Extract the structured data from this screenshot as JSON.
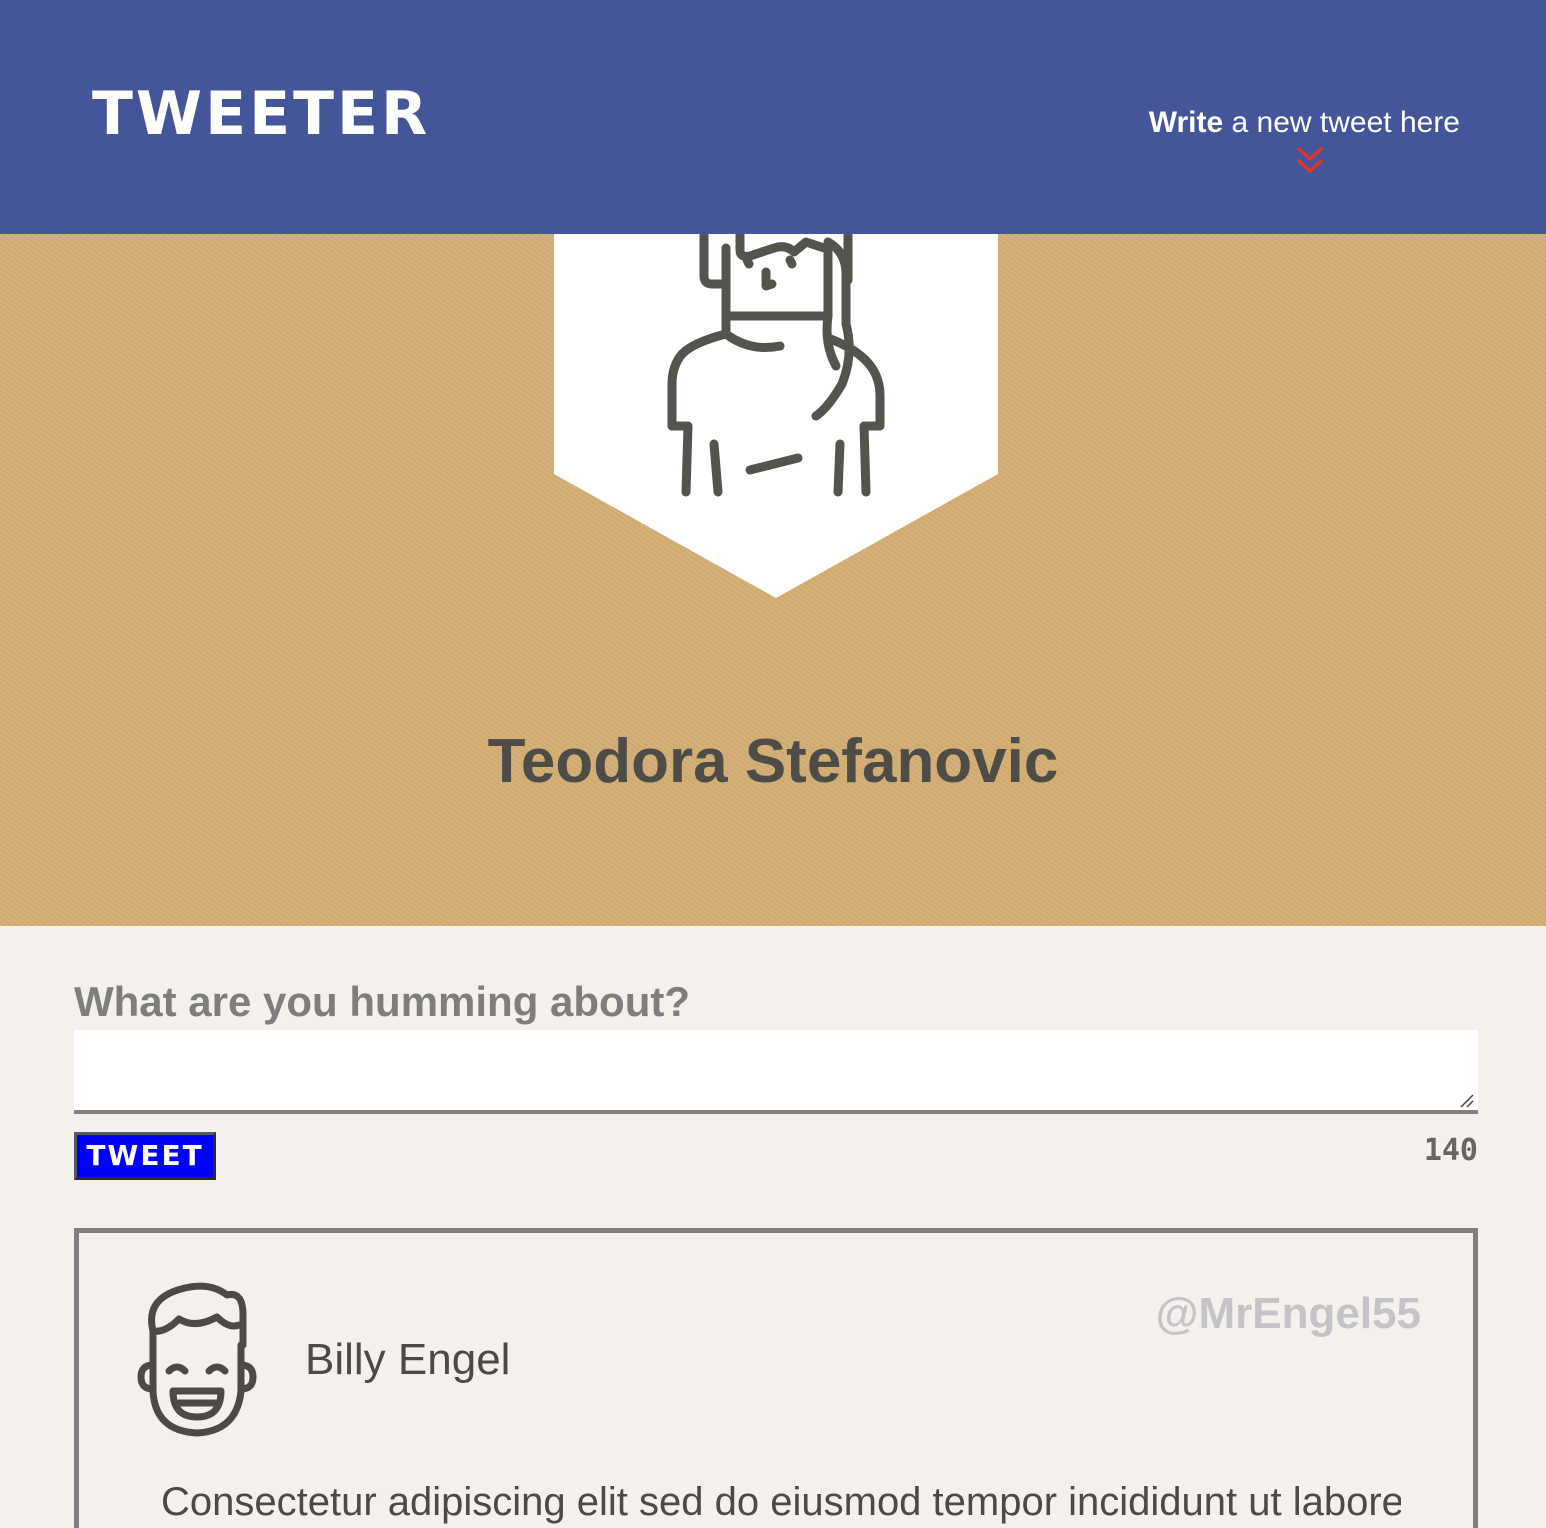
{
  "header": {
    "brand": "TWEETER",
    "compose_link_bold": "Write",
    "compose_link_rest": " a new tweet here",
    "chevron_icon": "chevron-double-down-icon",
    "chevron_color": "#e0342a",
    "background_color": "#45559a"
  },
  "profile": {
    "name": "Teodora Stefanovic",
    "avatar_icon": "woman-avatar-icon",
    "banner_color": "#d3ae74"
  },
  "composer": {
    "prompt": "What are you humming about?",
    "input_value": "",
    "button_label": "TWEET",
    "button_color": "#0000ff",
    "char_count": "140"
  },
  "tweets": [
    {
      "avatar_icon": "man-avatar-icon",
      "author": "Billy Engel",
      "handle": "@MrEngel55",
      "body": "Consectetur adipiscing elit sed do eiusmod tempor incididunt ut labore"
    }
  ]
}
